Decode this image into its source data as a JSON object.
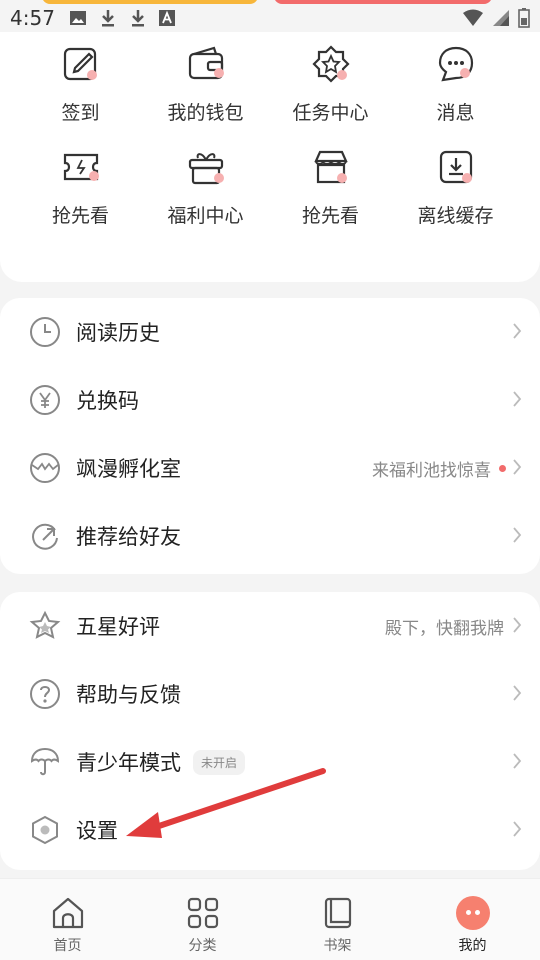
{
  "status_bar": {
    "time": "4:57"
  },
  "grid": {
    "items": [
      {
        "label": "签到",
        "icon": "edit-icon"
      },
      {
        "label": "我的钱包",
        "icon": "wallet-icon"
      },
      {
        "label": "任务中心",
        "icon": "badge-star-icon"
      },
      {
        "label": "消息",
        "icon": "chat-bubble-icon"
      },
      {
        "label": "抢先看",
        "icon": "ticket-icon"
      },
      {
        "label": "福利中心",
        "icon": "gift-icon"
      },
      {
        "label": "抢先看",
        "icon": "store-icon"
      },
      {
        "label": "离线缓存",
        "icon": "download-box-icon"
      }
    ]
  },
  "list_a": {
    "items": [
      {
        "label": "阅读历史",
        "sub": "",
        "icon": "clock-icon"
      },
      {
        "label": "兑换码",
        "sub": "",
        "icon": "yen-coin-icon"
      },
      {
        "label": "飒漫孵化室",
        "sub": "来福利池找惊喜",
        "icon": "egg-icon"
      },
      {
        "label": "推荐给好友",
        "sub": "",
        "icon": "share-icon"
      }
    ]
  },
  "list_b": {
    "items": [
      {
        "label": "五星好评",
        "sub": "殿下，快翻我牌",
        "icon": "star-icon"
      },
      {
        "label": "帮助与反馈",
        "sub": "",
        "icon": "help-icon"
      },
      {
        "label": "青少年模式",
        "sub": "",
        "badge": "未开启",
        "icon": "umbrella-icon"
      },
      {
        "label": "设置",
        "sub": "",
        "icon": "settings-hexagon-icon"
      }
    ]
  },
  "bottom_nav": {
    "items": [
      {
        "label": "首页",
        "icon": "home-icon"
      },
      {
        "label": "分类",
        "icon": "grid-icon"
      },
      {
        "label": "书架",
        "icon": "book-icon"
      },
      {
        "label": "我的",
        "icon": "profile-face-icon"
      }
    ]
  },
  "colors": {
    "accent_red": "#f26b6b",
    "accent_pink": "#f6b0b0",
    "annotation_arrow": "#e03c3c"
  }
}
